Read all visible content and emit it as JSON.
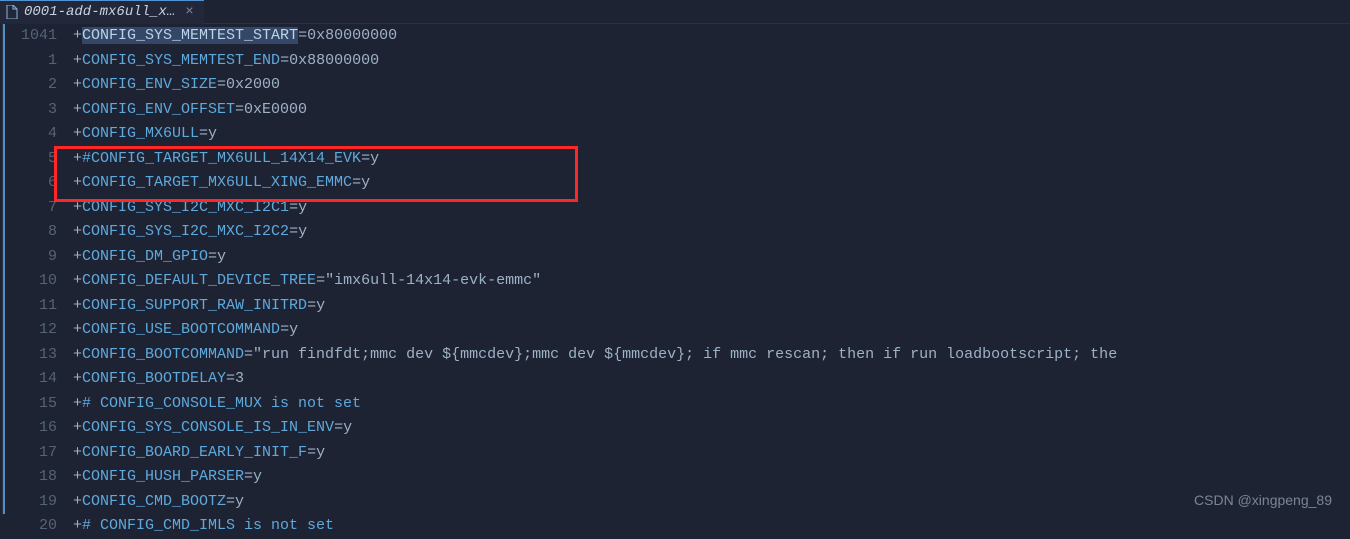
{
  "tab": {
    "title": "0001-add-mx6ull_x…",
    "close": "×"
  },
  "gutter": [
    "1041",
    "1",
    "2",
    "3",
    "4",
    "5",
    "6",
    "7",
    "8",
    "9",
    "10",
    "11",
    "12",
    "13",
    "14",
    "15",
    "16",
    "17",
    "18",
    "19",
    "20"
  ],
  "lines": [
    {
      "plus": "+",
      "body": "CONFIG_SYS_MEMTEST_START=0x80000000",
      "selected": true
    },
    {
      "plus": "+",
      "body": "CONFIG_SYS_MEMTEST_END=0x88000000"
    },
    {
      "plus": "+",
      "body": "CONFIG_ENV_SIZE=0x2000"
    },
    {
      "plus": "+",
      "body": "CONFIG_ENV_OFFSET=0xE0000"
    },
    {
      "plus": "+",
      "body": "CONFIG_MX6ULL=y"
    },
    {
      "plus": "+",
      "body": "#CONFIG_TARGET_MX6ULL_14X14_EVK=y"
    },
    {
      "plus": "+",
      "body": "CONFIG_TARGET_MX6ULL_XING_EMMC=y"
    },
    {
      "plus": "+",
      "body": "CONFIG_SYS_I2C_MXC_I2C1=y"
    },
    {
      "plus": "+",
      "body": "CONFIG_SYS_I2C_MXC_I2C2=y"
    },
    {
      "plus": "+",
      "body": "CONFIG_DM_GPIO=y"
    },
    {
      "plus": "+",
      "body": "CONFIG_DEFAULT_DEVICE_TREE=\"imx6ull-14x14-evk-emmc\""
    },
    {
      "plus": "+",
      "body": "CONFIG_SUPPORT_RAW_INITRD=y"
    },
    {
      "plus": "+",
      "body": "CONFIG_USE_BOOTCOMMAND=y"
    },
    {
      "plus": "+",
      "body": "CONFIG_BOOTCOMMAND=\"run findfdt;mmc dev ${mmcdev};mmc dev ${mmcdev}; if mmc rescan; then if run loadbootscript; the"
    },
    {
      "plus": "+",
      "body": "CONFIG_BOOTDELAY=3"
    },
    {
      "plus": "+",
      "body": "# CONFIG_CONSOLE_MUX is not set"
    },
    {
      "plus": "+",
      "body": "CONFIG_SYS_CONSOLE_IS_IN_ENV=y"
    },
    {
      "plus": "+",
      "body": "CONFIG_BOARD_EARLY_INIT_F=y"
    },
    {
      "plus": "+",
      "body": "CONFIG_HUSH_PARSER=y"
    },
    {
      "plus": "+",
      "body": "CONFIG_CMD_BOOTZ=y"
    },
    {
      "plus": "+",
      "body": "# CONFIG_CMD_IMLS is not set"
    }
  ],
  "highlight_rows": [
    5,
    6
  ],
  "watermark": "CSDN @xingpeng_89"
}
